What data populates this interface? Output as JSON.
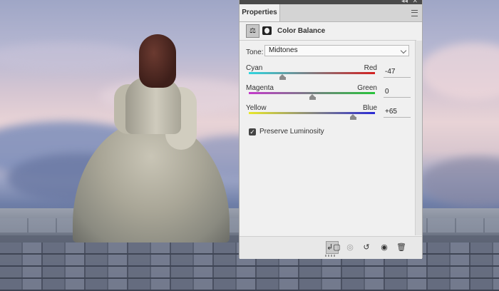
{
  "panel": {
    "tab_label": "Properties",
    "adjustment_title": "Color Balance",
    "tone": {
      "label": "Tone:",
      "selected": "Midtones"
    },
    "sliders": [
      {
        "left_label": "Cyan",
        "right_label": "Red",
        "value": "-47",
        "numeric": -47,
        "gradient": [
          "#2fd6e0",
          "#d42020"
        ]
      },
      {
        "left_label": "Magenta",
        "right_label": "Green",
        "value": "0",
        "numeric": 0,
        "gradient": [
          "#c43acb",
          "#27c43a"
        ]
      },
      {
        "left_label": "Yellow",
        "right_label": "Blue",
        "value": "+65",
        "numeric": 65,
        "gradient": [
          "#e8e82a",
          "#2a2ad6"
        ]
      }
    ],
    "preserve_luminosity": {
      "label": "Preserve Luminosity",
      "checked": true
    },
    "bottom_icons": [
      "clip-to-layer-icon",
      "view-previous-state-icon",
      "reset-icon",
      "visibility-eye-icon",
      "delete-trash-icon"
    ]
  }
}
